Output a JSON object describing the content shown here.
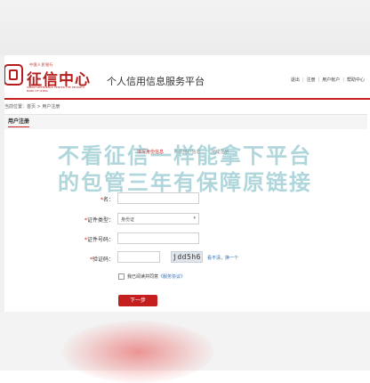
{
  "logo": {
    "top_text": "中国人民银行",
    "name": "征信中心",
    "english": "CREDIT REFERENCE CENTER THE PEOPLE'S BANK OF CHINA"
  },
  "header": {
    "site_title": "个人信用信息服务平台",
    "links": [
      "退出",
      "注册",
      "用户帐户",
      "帮助中心"
    ]
  },
  "breadcrumb": "当前位置：首页 > 用户注册",
  "section": {
    "title": "用户注册"
  },
  "steps": [
    "填写身份信息",
    "补充用户信息",
    "完成注册"
  ],
  "watermark": {
    "line1": "不看征信一样能拿下平台",
    "line2": "的包管三年有保障原链接"
  },
  "form": {
    "name_label": "名：",
    "id_type_label": "证件类型：",
    "id_type_value": "身份证",
    "id_number_label": "证件号码：",
    "captcha_label": "验证码：",
    "captcha_text": "jdd5h6",
    "captcha_refresh": "看不清，换一个",
    "agree_text": "我已阅读并同意",
    "agree_link": "《服务协议》",
    "next_label": "下一步",
    "required_mark": "*"
  },
  "colors": {
    "brand_red": "#c81f1f",
    "link_blue": "#2a6db5",
    "watermark": "#6eb4be"
  }
}
